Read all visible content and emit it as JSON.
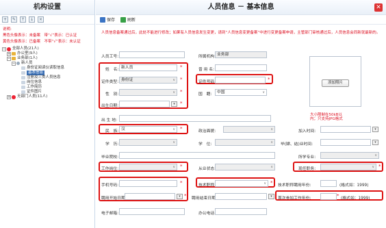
{
  "left": {
    "title": "机构设置",
    "desc_title": "说明:",
    "desc_lines": [
      "黑色头像表示：未备案　带“√”表示：已认证",
      "黄色头像表示：已备案　不带“√”表示：未认证"
    ],
    "tree": [
      {
        "label": "全部人员(21人)",
        "level": 0,
        "toggle": "−",
        "icon": "red"
      },
      {
        "label": "办公室(9人)",
        "level": 1,
        "toggle": "+",
        "icon": "folder"
      },
      {
        "label": "业务部(1人)",
        "level": 1,
        "toggle": "−",
        "icon": "folder"
      },
      {
        "label": "新人员",
        "level": 2,
        "toggle": "−",
        "icon": "person"
      },
      {
        "label": "身份证阅读仪读取信息",
        "level": 3,
        "toggle": "",
        "icon": "page"
      },
      {
        "label": "基本信息",
        "level": 3,
        "toggle": "",
        "icon": "page",
        "selected": true
      },
      {
        "label": "注册及三类人员信息",
        "level": 3,
        "toggle": "",
        "icon": "page"
      },
      {
        "label": "岗位信息",
        "level": 3,
        "toggle": "",
        "icon": "page"
      },
      {
        "label": "工作简历",
        "level": 3,
        "toggle": "",
        "icon": "page"
      },
      {
        "label": "证件图片",
        "level": 3,
        "toggle": "",
        "icon": "page"
      },
      {
        "label": "无部门人员(11人)",
        "level": 1,
        "toggle": "+",
        "icon": "red"
      }
    ]
  },
  "main": {
    "title": "人员信息 － 基本信息",
    "close": "✕",
    "save_label": "保存",
    "refresh_label": "刷新",
    "notice": "人员信息备案通过后，此处不能进行修改；如果有人员信息发生变更，请到“人员信息变更备案”中进行变更备案申请，主管部门审核通过后，人员信息会同新就最新的。",
    "add_photo": "添加照片",
    "photo_hint": [
      "大小限制在50kB以",
      "内；只支持JPG格式"
    ],
    "fields": {
      "staff_no": {
        "label": "人员工号:",
        "value": ""
      },
      "dept": {
        "label": "所属机构:",
        "value": "业务部"
      },
      "name": {
        "label": "姓　名:",
        "value": "新人员"
      },
      "used_name": {
        "label": "曾 用 名:",
        "value": ""
      },
      "id_type": {
        "label": "证件类型:",
        "value": "身份证"
      },
      "id_no": {
        "label": "证件号码:",
        "value": ""
      },
      "gender": {
        "label": "性　别:",
        "value": ""
      },
      "country": {
        "label": "国　籍:",
        "value": "中国"
      },
      "birth": {
        "label": "出生日期:",
        "value": ""
      },
      "birthplace": {
        "label": "出 生 地:",
        "value": ""
      },
      "ethnic": {
        "label": "民　族:",
        "value": "汉"
      },
      "politics": {
        "label": "政治面貌:",
        "value": ""
      },
      "join_time": {
        "label": "加入时间:",
        "value": ""
      },
      "edu": {
        "label": "学　历:",
        "value": ""
      },
      "degree": {
        "label": "学　位:",
        "value": ""
      },
      "grad_time": {
        "label": "毕(肄、结)业时间:",
        "value": ""
      },
      "school": {
        "label": "毕业院校:",
        "value": ""
      },
      "major": {
        "label": "所学专业:",
        "value": ""
      },
      "post": {
        "label": "工作岗位:",
        "value": ""
      },
      "status": {
        "label": "从业状态:",
        "value": ""
      },
      "duty": {
        "label": "现任职务:",
        "value": ""
      },
      "mobile": {
        "label": "手机号码:",
        "value": ""
      },
      "title": {
        "label": "技术职称:",
        "value": ""
      },
      "title_year": {
        "label": "技术职称聘用年份:",
        "value": "",
        "hint": "(格式如：1999)"
      },
      "hire_start": {
        "label": "聘用开始日期:",
        "value": ""
      },
      "hire_end": {
        "label": "聘用结束日期:",
        "value": ""
      },
      "first_work": {
        "label": "首次参加工作年份:",
        "value": "",
        "hint": "(格式如：1999)"
      },
      "email": {
        "label": "电子邮箱:",
        "value": ""
      },
      "office_phone": {
        "label": "办公电话:",
        "value": ""
      }
    }
  }
}
